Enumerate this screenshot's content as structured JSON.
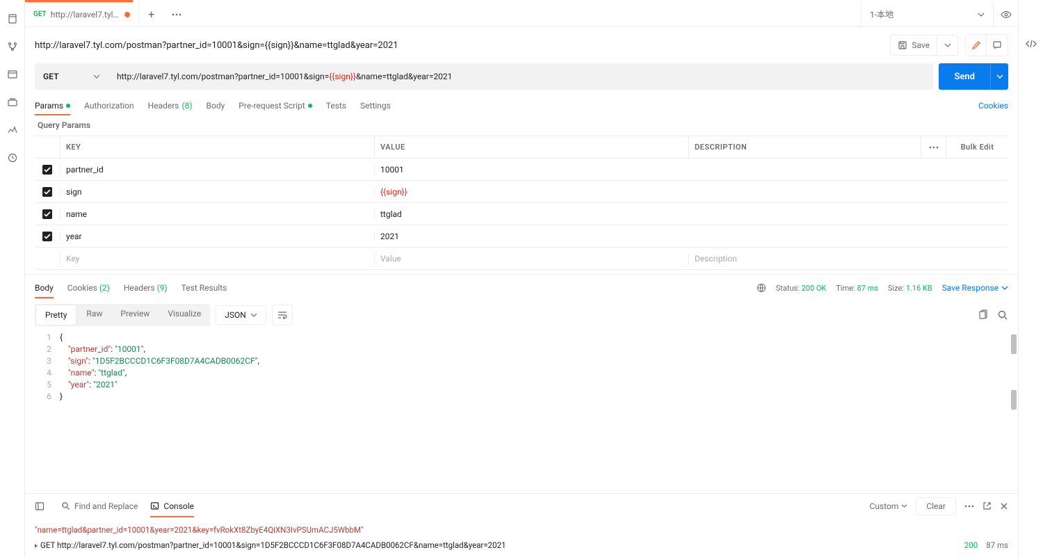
{
  "tab": {
    "method": "GET",
    "title": "http://laravel7.tyl.c..."
  },
  "env": {
    "name": "1-本地"
  },
  "request": {
    "title": "http://laravel7.tyl.com/postman?partner_id=10001&sign={{sign}}&name=ttglad&year=2021",
    "method": "GET",
    "url_pre": "http://laravel7.tyl.com/postman?partner_id=10001&sign=",
    "url_var": "{{sign}}",
    "url_post": "&name=ttglad&year=2021",
    "save_label": "Save",
    "send_label": "Send"
  },
  "req_tabs": {
    "params": "Params",
    "auth": "Authorization",
    "headers": "Headers",
    "headers_cnt": "(8)",
    "body": "Body",
    "prereq": "Pre-request Script",
    "tests": "Tests",
    "settings": "Settings",
    "cookies": "Cookies",
    "section": "Query Params"
  },
  "table": {
    "h_key": "KEY",
    "h_val": "VALUE",
    "h_desc": "DESCRIPTION",
    "bulk": "Bulk Edit",
    "rows": [
      {
        "k": "partner_id",
        "v": "10001",
        "var": false
      },
      {
        "k": "sign",
        "v": "{{sign}}",
        "var": true
      },
      {
        "k": "name",
        "v": "ttglad",
        "var": false
      },
      {
        "k": "year",
        "v": "2021",
        "var": false
      }
    ],
    "ph_key": "Key",
    "ph_val": "Value",
    "ph_desc": "Description"
  },
  "resp": {
    "body": "Body",
    "cookies": "Cookies",
    "cookies_cnt": "(2)",
    "headers": "Headers",
    "headers_cnt": "(9)",
    "tests": "Test Results",
    "status_lbl": "Status:",
    "status_val": "200 OK",
    "time_lbl": "Time:",
    "time_val": "87 ms",
    "size_lbl": "Size:",
    "size_val": "1.16 KB",
    "save": "Save Response"
  },
  "view": {
    "pretty": "Pretty",
    "raw": "Raw",
    "preview": "Preview",
    "visualize": "Visualize",
    "fmt": "JSON"
  },
  "json_body": [
    {
      "n": "1",
      "t": "{"
    },
    {
      "n": "2",
      "k": "partner_id",
      "v": "10001",
      "comma": true
    },
    {
      "n": "3",
      "k": "sign",
      "v": "1D5F2BCCCD1C6F3F08D7A4CADB0062CF",
      "comma": true
    },
    {
      "n": "4",
      "k": "name",
      "v": "ttglad",
      "comma": true
    },
    {
      "n": "5",
      "k": "year",
      "v": "2021",
      "comma": false
    },
    {
      "n": "6",
      "t": "}"
    }
  ],
  "bottom": {
    "find": "Find and Replace",
    "console": "Console",
    "custom": "Custom",
    "clear": "Clear"
  },
  "console_lines": {
    "l1": "\"name=ttglad&partner_id=10001&year=2021&key=fvRokXt8ZbyE4QiXN3IvPSUmACJ5WbbM\"",
    "l2_method": "GET",
    "l2_url": "http://laravel7.tyl.com/postman?partner_id=10001&sign=1D5F2BCCCD1C6F3F08D7A4CADB0062CF&name=ttglad&year=2021",
    "l2_code": "200",
    "l2_time": "87 ms"
  }
}
